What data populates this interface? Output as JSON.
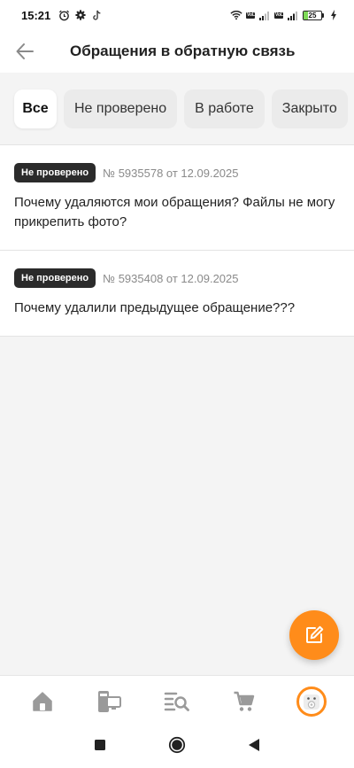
{
  "status_bar": {
    "time": "15:21",
    "left_icons": [
      "alarm-icon",
      "gear-icon",
      "tiktok-icon"
    ],
    "sim_tags": [
      "VoLTE",
      "VoLTE"
    ],
    "network": "4G+",
    "battery_level": "25",
    "battery_fraction": 0.25
  },
  "header": {
    "back_icon": "arrow-left-icon",
    "title": "Обращения в обратную связь"
  },
  "filters": [
    {
      "label": "Все",
      "active": true
    },
    {
      "label": "Не проверено",
      "active": false
    },
    {
      "label": "В работе",
      "active": false
    },
    {
      "label": "Закрыто",
      "active": false
    }
  ],
  "tickets": [
    {
      "status": "Не проверено",
      "number": "№ 5935578 от 12.09.2025",
      "text": "Почему удаляются мои обращения? Файлы не могу прикрепить фото?"
    },
    {
      "status": "Не проверено",
      "number": "№ 5935408 от 12.09.2025",
      "text": "Почему удалили предыдущее обращение???"
    }
  ],
  "fab": {
    "icon": "edit-icon",
    "color": "#ff8c1a"
  },
  "bottom_nav": [
    {
      "icon": "home-icon",
      "active": false
    },
    {
      "icon": "devices-icon",
      "active": false
    },
    {
      "icon": "search-list-icon",
      "active": false
    },
    {
      "icon": "cart-icon",
      "active": false
    },
    {
      "icon": "profile-icon",
      "active": true
    }
  ],
  "system_nav": [
    "recents-icon",
    "home-circle-icon",
    "back-triangle-icon"
  ],
  "colors": {
    "accent": "#ff8c1a",
    "badge_bg": "#2b2b2b",
    "icon_gray": "#9a9a9a"
  }
}
